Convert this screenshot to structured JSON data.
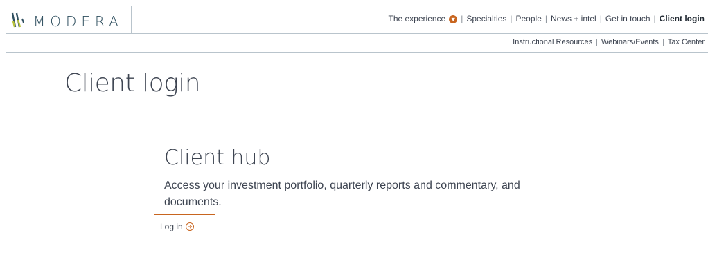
{
  "brand": {
    "name": "MODERA"
  },
  "main_nav": {
    "items": [
      {
        "label": "The experience",
        "has_badge": true
      },
      {
        "label": "Specialties"
      },
      {
        "label": "People"
      },
      {
        "label": "News + intel"
      },
      {
        "label": "Get in touch"
      },
      {
        "label": "Client login",
        "active": true
      }
    ],
    "badge_icon": "chevron-down-icon"
  },
  "sub_nav": {
    "items": [
      {
        "label": "Instructional Resources"
      },
      {
        "label": "Webinars/Events"
      },
      {
        "label": "Tax Center"
      }
    ]
  },
  "page": {
    "title": "Client login",
    "hub": {
      "title": "Client hub",
      "description": "Access your investment portfolio, quarterly reports and commentary, and documents.",
      "login_label": "Log in",
      "login_icon": "arrow-right-circle-icon"
    }
  },
  "colors": {
    "accent": "#c8651f",
    "text": "#3d4451",
    "divider": "#b9c4cc",
    "logo_text": "#2f4f5f"
  }
}
